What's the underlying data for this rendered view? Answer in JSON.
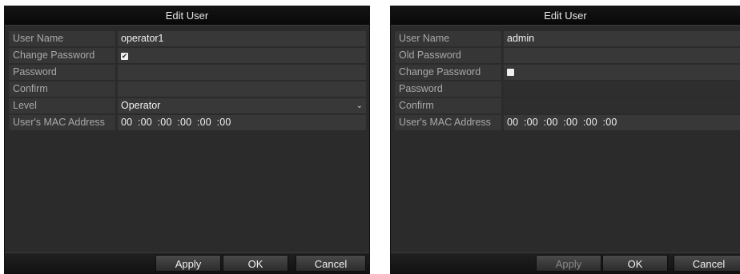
{
  "left_dialog": {
    "title": "Edit User",
    "rows": {
      "user_name": {
        "label": "User Name",
        "value": "operator1"
      },
      "change_pw": {
        "label": "Change Password",
        "checked": true,
        "mark": "✔"
      },
      "password": {
        "label": "Password",
        "value": ""
      },
      "confirm": {
        "label": "Confirm",
        "value": ""
      },
      "level": {
        "label": "Level",
        "value": "Operator",
        "icon": "chevron-down-icon"
      },
      "mac": {
        "label": "User's MAC Address",
        "value": "00 :00 :00 :00 :00 :00"
      }
    },
    "buttons": {
      "apply": "Apply",
      "ok": "OK",
      "cancel": "Cancel"
    }
  },
  "right_dialog": {
    "title": "Edit User",
    "rows": {
      "user_name": {
        "label": "User Name",
        "value": "admin"
      },
      "old_pw": {
        "label": "Old Password",
        "value": ""
      },
      "change_pw": {
        "label": "Change Password",
        "checked": false,
        "mark": ""
      },
      "password": {
        "label": "Password",
        "value": ""
      },
      "confirm": {
        "label": "Confirm",
        "value": ""
      },
      "mac": {
        "label": "User's MAC Address",
        "value": "00 :00 :00 :00 :00 :00"
      }
    },
    "buttons": {
      "apply": "Apply",
      "ok": "OK",
      "cancel": "Cancel"
    }
  },
  "colors": {
    "dialog_bg": "#2b2b2b",
    "row_label_bg": "#363636",
    "text": "#f2f2f2",
    "label_text": "#a9a9a9"
  }
}
